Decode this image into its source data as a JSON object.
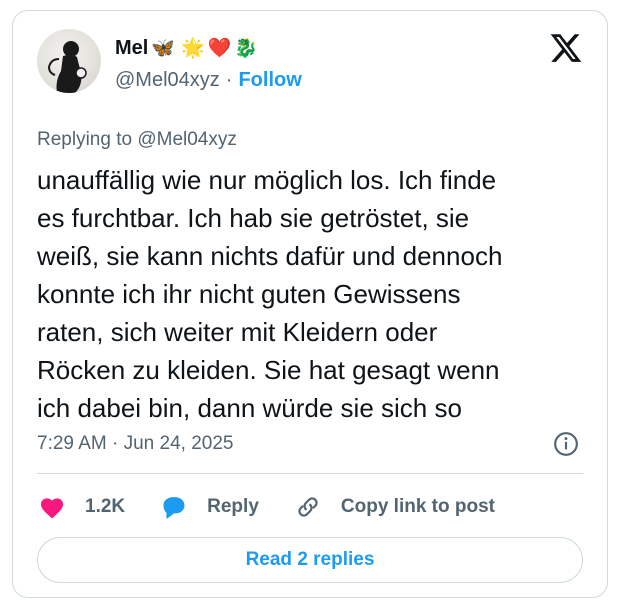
{
  "author": {
    "name": "Mel",
    "handle": "@Mel04xyz",
    "separator": "·",
    "follow_label": "Follow",
    "badges": [
      "🦋",
      "🌟",
      "❤️",
      "🐉"
    ]
  },
  "tweet": {
    "replying_to": "Replying to @Mel04xyz",
    "text_lines": [
      "unauffällig wie nur möglich los. Ich finde",
      "es furchtbar. Ich hab sie getröstet, sie",
      "weiß, sie kann nichts dafür und dennoch",
      "konnte ich ihr nicht guten Gewissens",
      "raten, sich weiter mit Kleidern oder",
      "Röcken zu kleiden. Sie hat gesagt wenn",
      "ich dabei bin, dann würde sie sich so"
    ],
    "timestamp": "7:29 AM · Jun 24, 2025"
  },
  "actions": {
    "like_count": "1.2K",
    "reply_label": "Reply",
    "copy_link_label": "Copy link to post"
  },
  "read_replies_label": "Read 2 replies",
  "colors": {
    "accent": "#1d9bf0",
    "like": "#f91880",
    "muted": "#536471",
    "border": "#cfd9de"
  },
  "icons": [
    "x-logo-icon",
    "info-icon",
    "heart-icon",
    "reply-bubble-icon",
    "link-icon"
  ]
}
